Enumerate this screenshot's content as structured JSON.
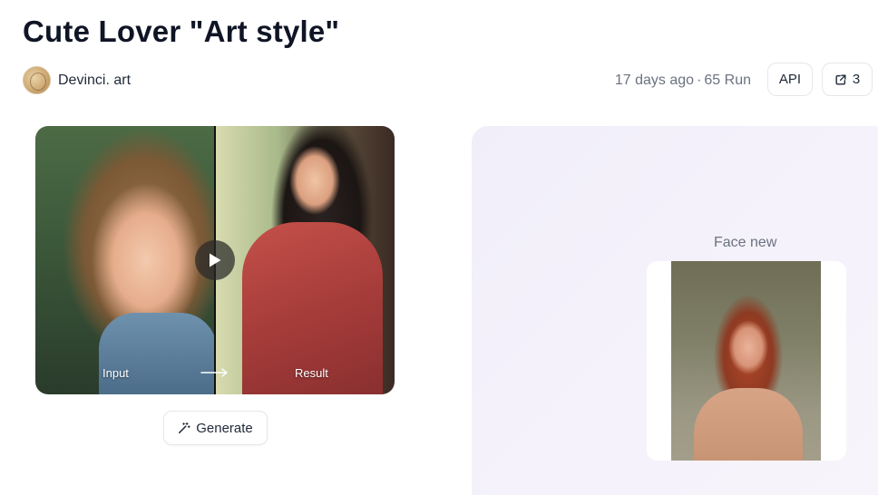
{
  "title": "Cute Lover \"Art style\"",
  "author": {
    "name": "Devinci. art"
  },
  "meta": {
    "time": "17 days ago",
    "separator": "·",
    "runs": "65 Run"
  },
  "actions": {
    "api_label": "API",
    "share_count": "3"
  },
  "preview": {
    "input_label": "Input",
    "result_label": "Result"
  },
  "generate_label": "Generate",
  "face": {
    "label": "Face new"
  },
  "icons": [
    "play-icon",
    "arrow-right-icon",
    "share-icon",
    "magic-wand-icon"
  ]
}
